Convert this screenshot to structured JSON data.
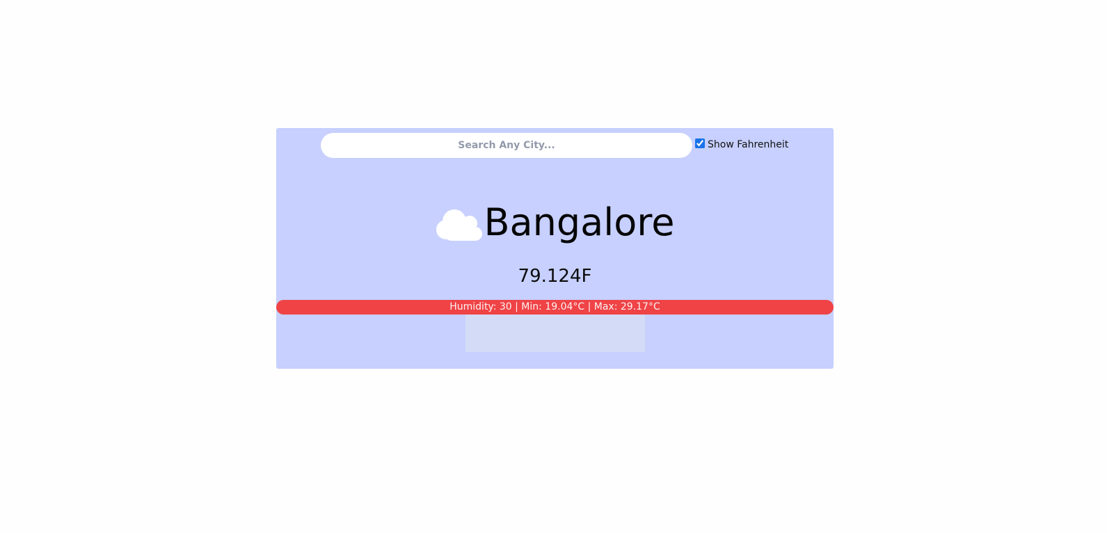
{
  "search": {
    "placeholder": "Search Any City...",
    "value": ""
  },
  "toggle": {
    "label": "Show Fahrenheit",
    "checked": true
  },
  "weather": {
    "icon": "cloud-icon",
    "city": "Bangalore",
    "temperature": "79.124F",
    "details": "Humidity: 30 | Min: 19.04°C | Max: 29.17°C"
  },
  "colors": {
    "card_background": "#c7d0fe",
    "info_bar": "#ef4346",
    "checkbox_accent": "#1a73e8"
  }
}
